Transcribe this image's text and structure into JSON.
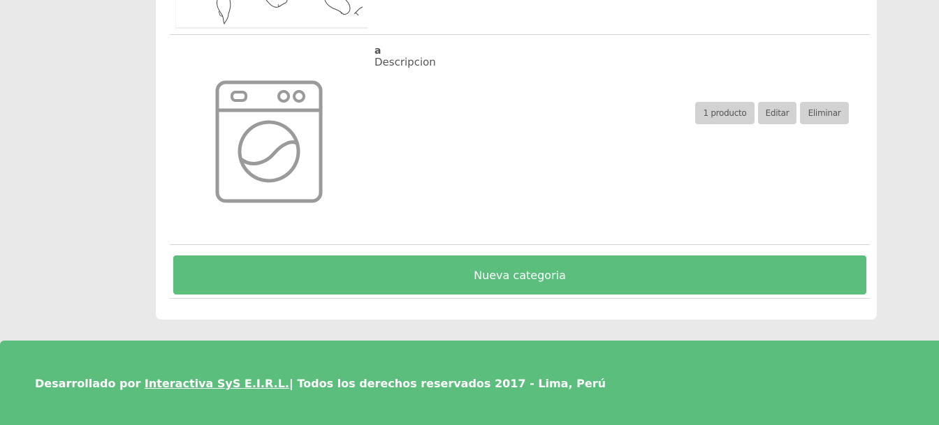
{
  "category": {
    "name": "a",
    "description": "Descripcion",
    "image_icon": "washing-machine-icon"
  },
  "actions": {
    "count_label": "1 producto",
    "edit_label": "Editar",
    "delete_label": "Eliminar"
  },
  "new_category_label": "Nueva categoria",
  "footer": {
    "prefix": "Desarrollado por ",
    "company_link": "Interactiva SyS E.I.R.L.",
    "suffix": "| Todos los derechos reservados 2017 - Lima, Perú"
  },
  "colors": {
    "accent_green": "#5bbe7c",
    "button_gray": "#d2d2d2",
    "background": "#e9e9e9"
  }
}
